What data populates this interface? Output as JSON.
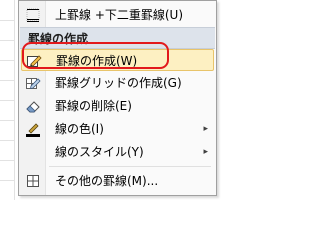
{
  "menu": {
    "top_item": {
      "label": "上罫線 +下二重罫線(U)",
      "icon": "border-top-double-bottom-icon"
    },
    "section_header": "罫線の作成",
    "items": [
      {
        "label": "罫線の作成(W)",
        "icon": "pencil-draw-border-icon",
        "highlighted": true,
        "has_submenu": false
      },
      {
        "label": "罫線グリッドの作成(G)",
        "icon": "pencil-draw-grid-icon",
        "highlighted": false,
        "has_submenu": false
      },
      {
        "label": "罫線の削除(E)",
        "icon": "eraser-icon",
        "highlighted": false,
        "has_submenu": false
      },
      {
        "label": "線の色(I)",
        "icon": "line-color-icon",
        "highlighted": false,
        "has_submenu": true
      },
      {
        "label": "線のスタイル(Y)",
        "icon": "",
        "highlighted": false,
        "has_submenu": true
      },
      {
        "label": "その他の罫線(M)...",
        "icon": "more-borders-grid-icon",
        "highlighted": false,
        "has_submenu": false
      }
    ],
    "submenu_arrow": "▸"
  },
  "colors": {
    "highlight_fill": "#fdf0c2",
    "highlight_border": "#e8c46a",
    "annotation_ring": "#e2191c",
    "header_fill": "#dde3eb"
  }
}
